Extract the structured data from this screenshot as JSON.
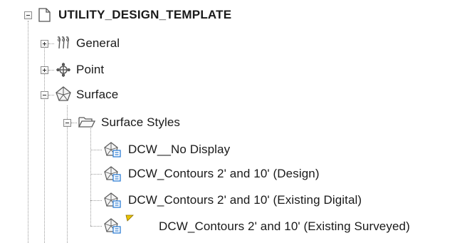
{
  "tree": {
    "root": {
      "label": "UTILITY_DESIGN_TEMPLATE",
      "icon": "document-icon",
      "expanded": true
    },
    "nodes": [
      {
        "label": "General",
        "icon": "general-settings-icon",
        "expanded": false
      },
      {
        "label": "Point",
        "icon": "point-icon",
        "expanded": false
      },
      {
        "label": "Surface",
        "icon": "surface-icon",
        "expanded": true
      }
    ],
    "surface_styles": {
      "label": "Surface Styles",
      "icon": "open-folder-icon",
      "expanded": true,
      "items": [
        {
          "label": "DCW__No Display",
          "icon": "surface-style-icon",
          "in_use": false
        },
        {
          "label": "DCW_Contours 2' and 10' (Design)",
          "icon": "surface-style-icon",
          "in_use": false
        },
        {
          "label": "DCW_Contours 2' and 10' (Existing Digital)",
          "icon": "surface-style-icon",
          "in_use": false
        },
        {
          "label": "DCW_Contours 2' and 10' (Existing Surveyed)",
          "icon": "surface-style-icon",
          "in_use": true
        }
      ]
    }
  },
  "colors": {
    "tree_line": "#9a9a9a",
    "expander_border": "#8c8c8c",
    "icon_stroke": "#5a5a5a",
    "style_icon_accent": "#2f7fd6",
    "in_use_marker": "#e8c200"
  }
}
